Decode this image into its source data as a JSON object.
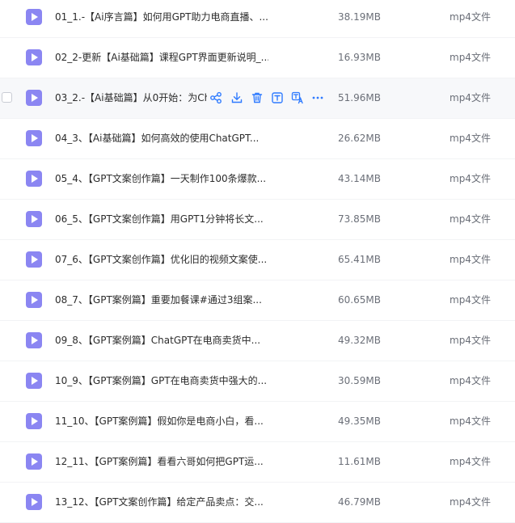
{
  "files": [
    {
      "name": "01_1.-【Ai序言篇】如何用GPT助力电商直播、...",
      "size": "38.19MB",
      "type": "mp4文件",
      "hover": false
    },
    {
      "name": "02_2-更新【Ai基础篇】课程GPT界面更新说明_...",
      "size": "16.93MB",
      "type": "mp4文件",
      "hover": false
    },
    {
      "name": "03_2.-【Ai基础篇】从0开始：为Ch",
      "size": "51.96MB",
      "type": "mp4文件",
      "hover": true
    },
    {
      "name": "04_3、【Ai基础篇】如何高效的使用ChatGPT...",
      "size": "26.62MB",
      "type": "mp4文件",
      "hover": false
    },
    {
      "name": "05_4、【GPT文案创作篇】一天制作100条爆款...",
      "size": "43.14MB",
      "type": "mp4文件",
      "hover": false
    },
    {
      "name": "06_5、【GPT文案创作篇】用GPT1分钟将长文...",
      "size": "73.85MB",
      "type": "mp4文件",
      "hover": false
    },
    {
      "name": "07_6、【GPT文案创作篇】优化旧的视频文案使...",
      "size": "65.41MB",
      "type": "mp4文件",
      "hover": false
    },
    {
      "name": "08_7、【GPT案例篇】重要加餐课#通过3组案...",
      "size": "60.65MB",
      "type": "mp4文件",
      "hover": false
    },
    {
      "name": "09_8、【GPT案例篇】ChatGPT在电商卖货中...",
      "size": "49.32MB",
      "type": "mp4文件",
      "hover": false
    },
    {
      "name": "10_9、【GPT案例篇】GPT在电商卖货中强大的...",
      "size": "30.59MB",
      "type": "mp4文件",
      "hover": false
    },
    {
      "name": "11_10、【GPT案例篇】假如你是电商小白，看...",
      "size": "49.35MB",
      "type": "mp4文件",
      "hover": false
    },
    {
      "name": "12_11、【GPT案例篇】看看六哥如何把GPT运...",
      "size": "11.61MB",
      "type": "mp4文件",
      "hover": false
    },
    {
      "name": "13_12、【GPT文案创作篇】给定产品卖点：交...",
      "size": "46.79MB",
      "type": "mp4文件",
      "hover": false
    }
  ],
  "row_actions": {
    "icons": [
      "share-icon",
      "download-icon",
      "delete-icon",
      "text-extract-icon",
      "translate-icon",
      "more-icon"
    ]
  },
  "colors": {
    "accent": "#2f7bff",
    "file_icon": "#8b86f2",
    "hover_row": "#f7f8fa"
  }
}
